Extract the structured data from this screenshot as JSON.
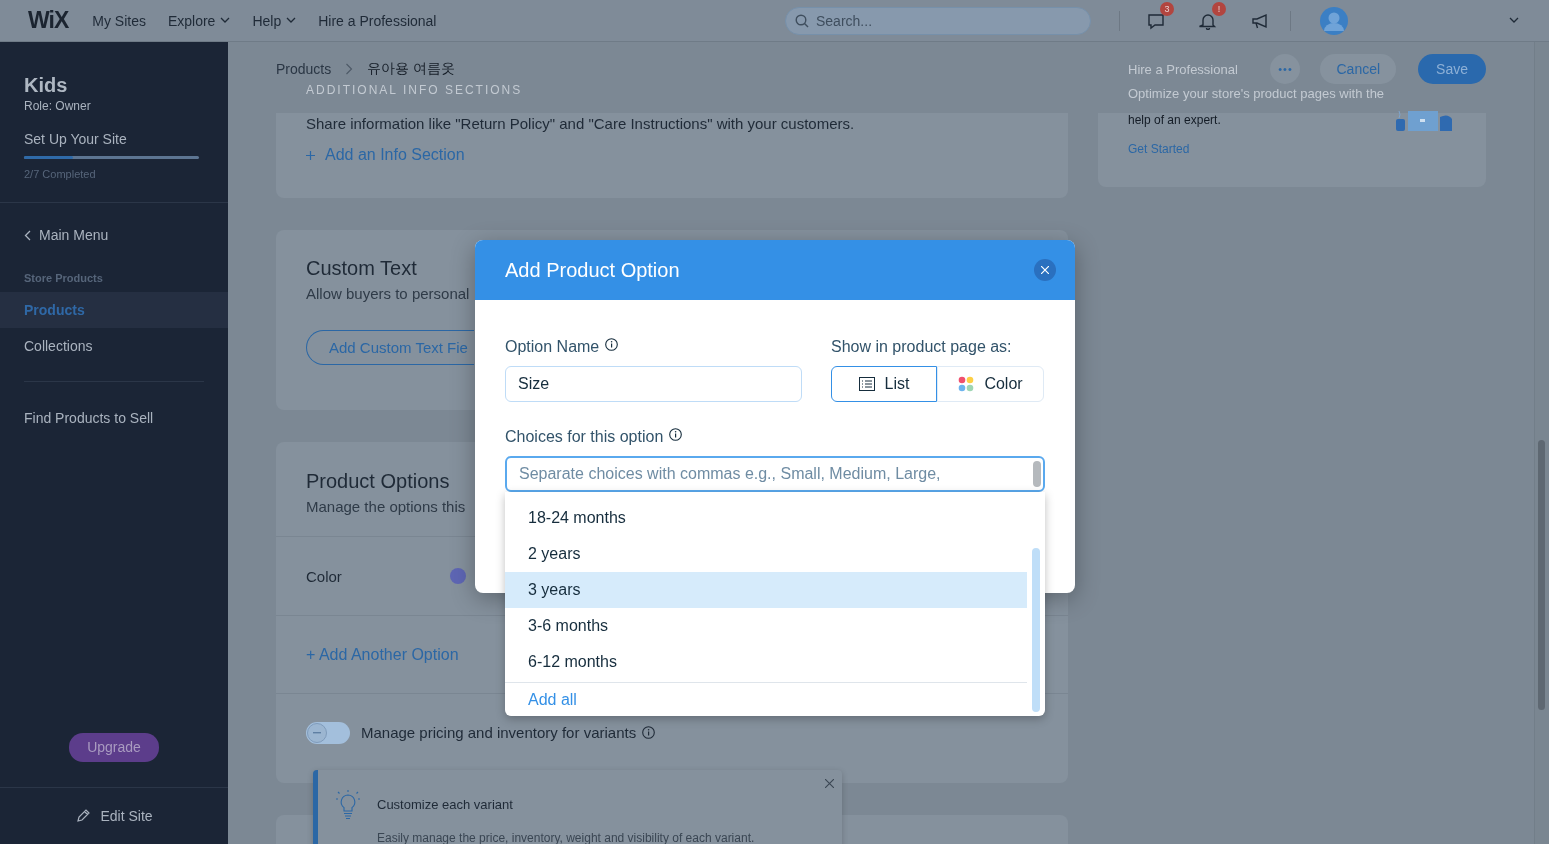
{
  "topbar": {
    "logo": "WiX",
    "nav": [
      {
        "label": "My Sites",
        "dropdown": false
      },
      {
        "label": "Explore",
        "dropdown": true
      },
      {
        "label": "Help",
        "dropdown": true
      },
      {
        "label": "Hire a Professional",
        "dropdown": false
      }
    ],
    "search": {
      "placeholder": "Search..."
    },
    "icons": [
      {
        "kind": "chat",
        "badge": "3"
      },
      {
        "kind": "bell",
        "badge": "!"
      },
      {
        "kind": "megaphone"
      }
    ]
  },
  "sidebar": {
    "site_name": "Kids",
    "role": "Role: Owner",
    "setup": {
      "title": "Set Up Your Site",
      "level": 0.28,
      "progress": "2/7 Completed"
    },
    "back": "Main Menu",
    "section": "Store Products",
    "items": [
      {
        "label": "Products",
        "selected": true
      },
      {
        "label": "Collections",
        "selected": false
      }
    ],
    "extra_items": [
      {
        "label": "Find Products to Sell"
      }
    ],
    "upgrade": "Upgrade",
    "edit_site": "Edit Site"
  },
  "breadcrumb": [
    "Products",
    "유아용 여름옷"
  ],
  "section_label": "ADDITIONAL INFO SECTIONS",
  "actions": {
    "more": "•••",
    "cancel": "Cancel",
    "save": "Save"
  },
  "hire_card": {
    "title": "Hire a Professional",
    "text_faded": "Optimize your store's product pages with the",
    "text": "help of an expert.",
    "link": "Get Started"
  },
  "info_card": {
    "text": "Share information like \"Return Policy\" and \"Care Instructions\" with your customers.",
    "link": "Add an Info Section"
  },
  "custom_text_card": {
    "title": "Custom Text",
    "description": "Allow buyers to personal",
    "button": "Add Custom Text Fie"
  },
  "product_options_card": {
    "title": "Product Options",
    "description": "Manage the options this",
    "options": [
      {
        "name": "Color",
        "color": "#5e66b4"
      }
    ],
    "add_link": "+ Add Another Option",
    "variants_toggle": {
      "label": "Manage pricing and inventory for variants",
      "on": false
    }
  },
  "tip": {
    "title": "Customize each variant",
    "text": "Easily manage the price, inventory, weight and visibility of each variant."
  },
  "dialog": {
    "title": "Add Product Option",
    "option_name": {
      "label": "Option Name",
      "value": "Size"
    },
    "display": {
      "label": "Show in product page as:",
      "choices": [
        {
          "label": "List",
          "kind": "list",
          "selected": true
        },
        {
          "label": "Color",
          "kind": "color",
          "selected": false
        }
      ]
    },
    "choices": {
      "label": "Choices for this option",
      "placeholder": "Separate choices with commas e.g., Small, Medium, Large,",
      "suggestions": [
        {
          "label": "18-24 months",
          "highlighted": false
        },
        {
          "label": "2 years",
          "highlighted": false
        },
        {
          "label": "3 years",
          "highlighted": true
        },
        {
          "label": "3-6 months",
          "highlighted": false
        },
        {
          "label": "6-12 months",
          "highlighted": false
        }
      ],
      "add_all": "Add all"
    }
  }
}
